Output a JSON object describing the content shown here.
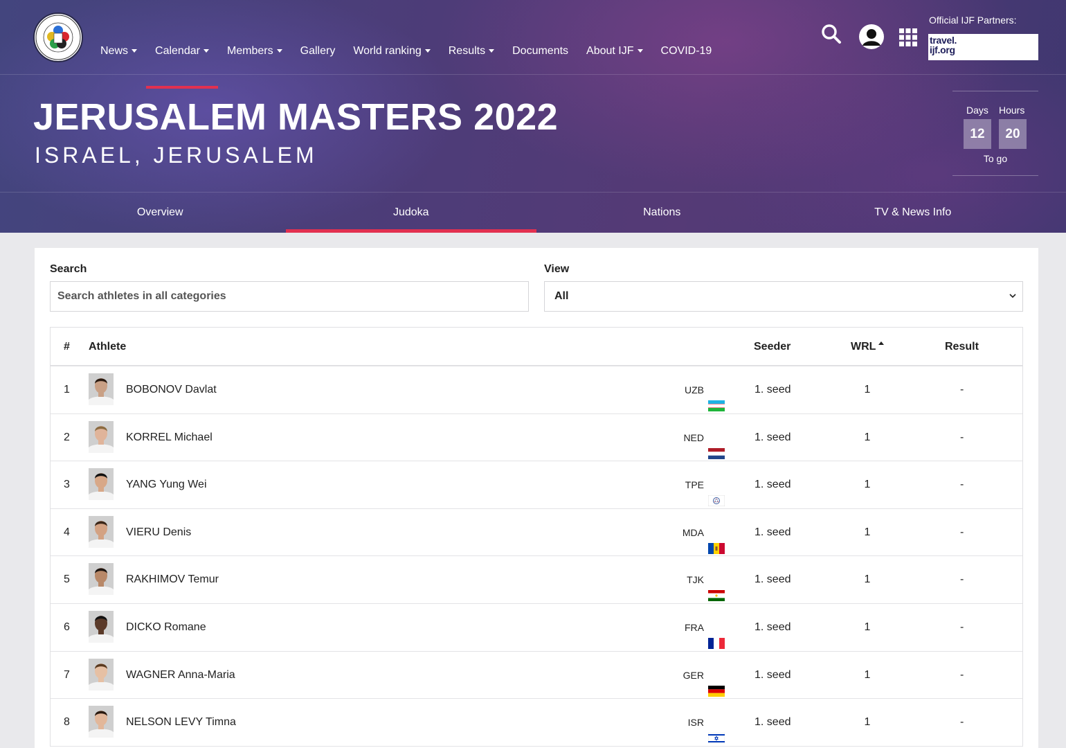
{
  "nav": {
    "items": [
      {
        "label": "News",
        "caret": true,
        "active": false
      },
      {
        "label": "Calendar",
        "caret": true,
        "active": true
      },
      {
        "label": "Members",
        "caret": true,
        "active": false
      },
      {
        "label": "Gallery",
        "caret": false,
        "active": false
      },
      {
        "label": "World ranking",
        "caret": true,
        "active": false
      },
      {
        "label": "Results",
        "caret": true,
        "active": false
      },
      {
        "label": "Documents",
        "caret": false,
        "active": false
      },
      {
        "label": "About IJF",
        "caret": true,
        "active": false
      },
      {
        "label": "COVID-19",
        "caret": false,
        "active": false
      }
    ],
    "icons": [
      "search-icon",
      "user-icon",
      "grid-icon"
    ]
  },
  "partners": {
    "label": "Official IJF Partners:",
    "logo_line1": "travel.",
    "logo_line2": "ijf.org"
  },
  "event": {
    "title": "JERUSALEM MASTERS 2022",
    "location": "ISRAEL, JERUSALEM"
  },
  "countdown": {
    "days_label": "Days",
    "hours_label": "Hours",
    "days": "12",
    "hours": "20",
    "suffix": "To go"
  },
  "tabs": [
    {
      "label": "Overview",
      "active": false
    },
    {
      "label": "Judoka",
      "active": true
    },
    {
      "label": "Nations",
      "active": false
    },
    {
      "label": "TV & News Info",
      "active": false
    }
  ],
  "filters": {
    "search_label": "Search",
    "search_placeholder": "Search athletes in all categories",
    "view_label": "View",
    "view_value": "All"
  },
  "table": {
    "headers": {
      "num": "#",
      "athlete": "Athlete",
      "seeder": "Seeder",
      "wrl": "WRL",
      "result": "Result"
    },
    "sort_column": "WRL",
    "rows": [
      {
        "num": "1",
        "name": "BOBONOV Davlat",
        "nation": "UZB",
        "seed": "1. seed",
        "wrl": "1",
        "result": "-"
      },
      {
        "num": "2",
        "name": "KORREL Michael",
        "nation": "NED",
        "seed": "1. seed",
        "wrl": "1",
        "result": "-"
      },
      {
        "num": "3",
        "name": "YANG Yung Wei",
        "nation": "TPE",
        "seed": "1. seed",
        "wrl": "1",
        "result": "-"
      },
      {
        "num": "4",
        "name": "VIERU Denis",
        "nation": "MDA",
        "seed": "1. seed",
        "wrl": "1",
        "result": "-"
      },
      {
        "num": "5",
        "name": "RAKHIMOV Temur",
        "nation": "TJK",
        "seed": "1. seed",
        "wrl": "1",
        "result": "-"
      },
      {
        "num": "6",
        "name": "DICKO Romane",
        "nation": "FRA",
        "seed": "1. seed",
        "wrl": "1",
        "result": "-"
      },
      {
        "num": "7",
        "name": "WAGNER Anna-Maria",
        "nation": "GER",
        "seed": "1. seed",
        "wrl": "1",
        "result": "-"
      },
      {
        "num": "8",
        "name": "NELSON LEVY Timna",
        "nation": "ISR",
        "seed": "1. seed",
        "wrl": "1",
        "result": "-"
      }
    ]
  },
  "colors": {
    "accent": "#e23050",
    "header_bg": "#4d3c78"
  }
}
